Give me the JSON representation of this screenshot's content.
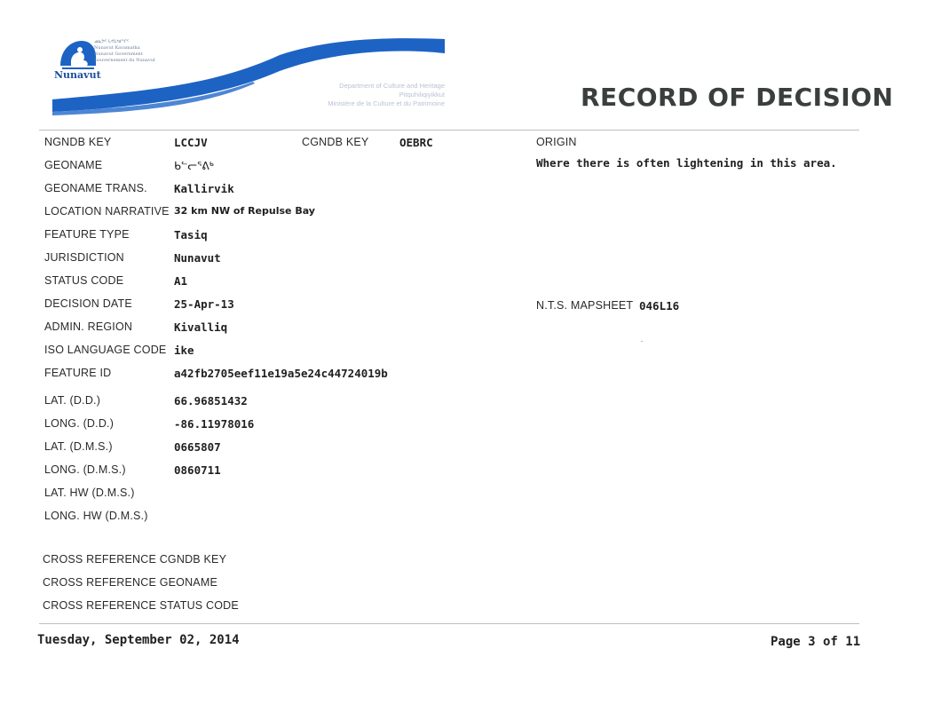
{
  "header": {
    "logo_word": "Nunavut",
    "logo_lines": [
      "ᓄᓇᕗᑦ ᒐᕙᒪᒃᑯᖏᑦ",
      "Nunavut Kavamatka",
      "Nunavut Government",
      "Gouvernement du Nunavut"
    ],
    "department_lines": [
      "Department of Culture and Heritage",
      "Pitquhiliqiyikkut",
      "Ministère de la Culture et du Patrimoine"
    ],
    "title": "RECORD OF DECISION",
    "colors": {
      "swoosh": "#1d63c4",
      "title": "#3a3f3c"
    }
  },
  "fields": {
    "ngndb_key": {
      "label": "NGNDB KEY",
      "value": "LCCJV"
    },
    "cgndb_key": {
      "label": "CGNDB KEY",
      "value": "OEBRC"
    },
    "origin": {
      "label": "ORIGIN",
      "value": "Where there is often lightening in this area."
    },
    "geoname": {
      "label": "GEONAME",
      "value": "ᑲᓪᓕᕐᕕᒃ"
    },
    "geoname_trans": {
      "label": "GEONAME TRANS.",
      "value": "Kallirvik"
    },
    "location_narrative": {
      "label": "LOCATION NARRATIVE",
      "value": "32 km NW of Repulse Bay"
    },
    "feature_type": {
      "label": "FEATURE TYPE",
      "value": "Tasiq"
    },
    "jurisdiction": {
      "label": "JURISDICTION",
      "value": "Nunavut"
    },
    "status_code": {
      "label": "STATUS CODE",
      "value": "A1"
    },
    "decision_date": {
      "label": "DECISION DATE",
      "value": "25-Apr-13"
    },
    "nts_mapsheet": {
      "label": "N.T.S. MAPSHEET",
      "value": "046L16"
    },
    "admin_region": {
      "label": "ADMIN. REGION",
      "value": "Kivalliq"
    },
    "iso_language_code": {
      "label": "ISO LANGUAGE CODE",
      "value": "ike"
    },
    "feature_id": {
      "label": "FEATURE ID",
      "value": "a42fb2705eef11e19a5e24c44724019b"
    },
    "lat_dd": {
      "label": "LAT. (D.D.)",
      "value": "66.96851432"
    },
    "long_dd": {
      "label": "LONG. (D.D.)",
      "value": "-86.11978016"
    },
    "lat_dms": {
      "label": "LAT. (D.M.S.)",
      "value": "0665807"
    },
    "long_dms": {
      "label": "LONG. (D.M.S.)",
      "value": "0860711"
    },
    "lat_hw_dms": {
      "label": "LAT. HW (D.M.S.)",
      "value": ""
    },
    "long_hw_dms": {
      "label": "LONG. HW (D.M.S.)",
      "value": ""
    }
  },
  "cross_reference": {
    "cgndb_key_label": "CROSS REFERENCE CGNDB KEY",
    "geoname_label": "CROSS REFERENCE GEONAME",
    "status_code_label": "CROSS REFERENCE STATUS CODE"
  },
  "footer": {
    "date": "Tuesday, September 02, 2014",
    "page": "Page 3 of 11"
  }
}
